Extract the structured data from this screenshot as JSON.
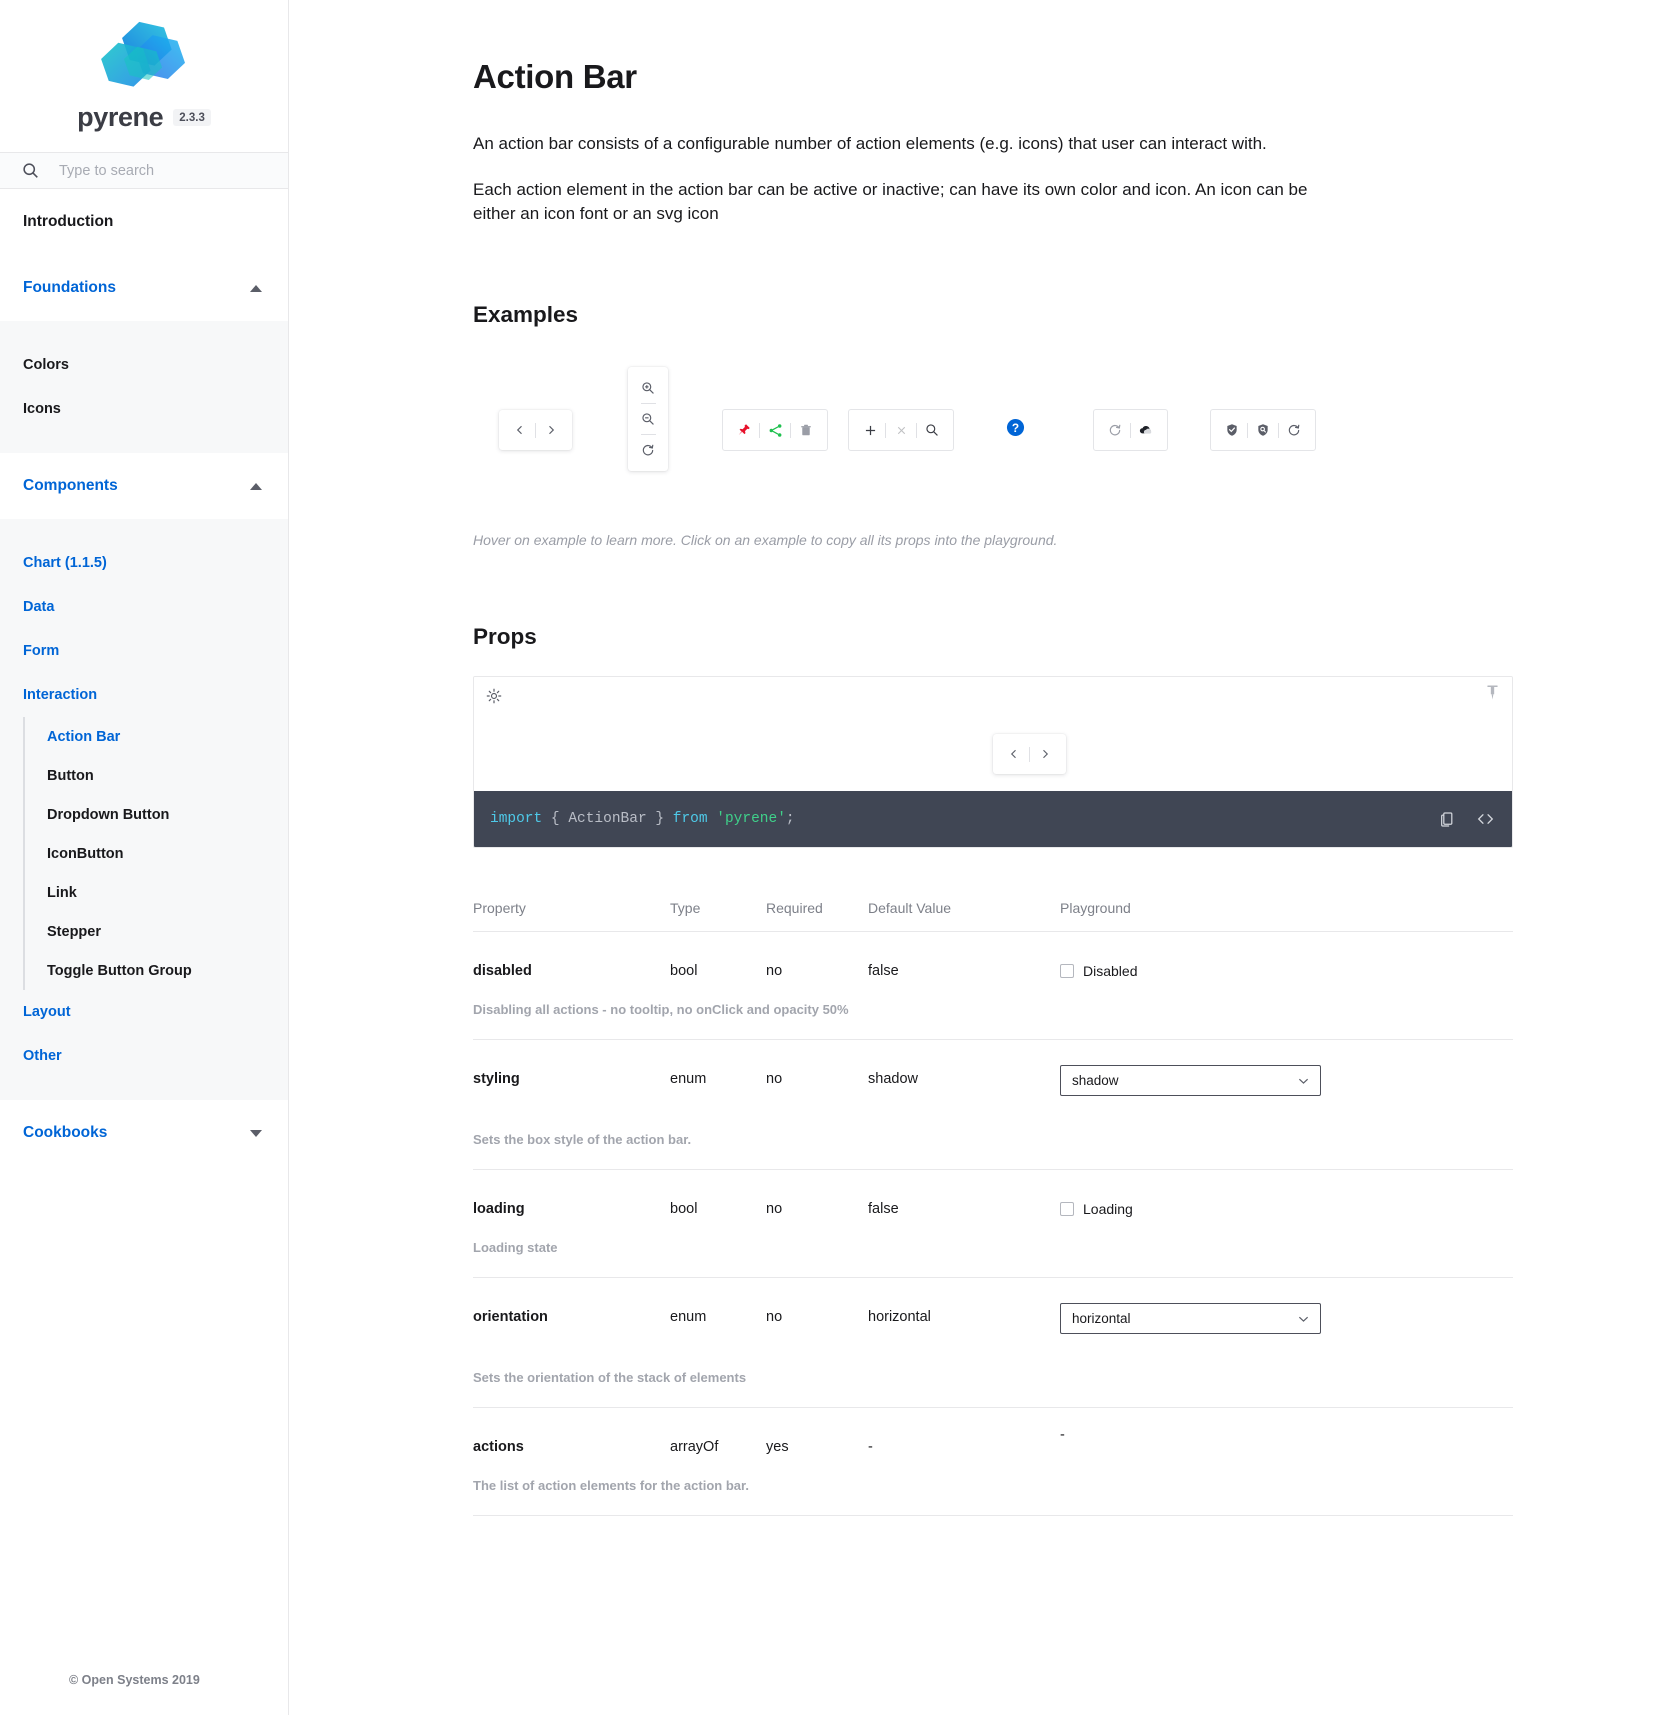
{
  "brand": {
    "name": "pyrene",
    "version": "2.3.3",
    "logo_icon": "pyrene-cube-logo"
  },
  "search": {
    "placeholder": "Type to search",
    "value": "",
    "icon": "search-icon"
  },
  "sidebar": {
    "introduction": "Introduction",
    "foundations": {
      "label": "Foundations",
      "chevron": "chevron-up-icon",
      "items": [
        "Colors",
        "Icons"
      ]
    },
    "components": {
      "label": "Components",
      "chevron": "chevron-up-icon",
      "items": [
        {
          "label": "Chart (1.1.5)"
        },
        {
          "label": "Data"
        },
        {
          "label": "Form"
        },
        {
          "label": "Interaction",
          "children": [
            "Action Bar",
            "Button",
            "Dropdown Button",
            "IconButton",
            "Link",
            "Stepper",
            "Toggle Button Group"
          ],
          "active_child": "Action Bar"
        },
        {
          "label": "Layout"
        },
        {
          "label": "Other"
        }
      ]
    },
    "cookbooks": {
      "label": "Cookbooks",
      "chevron": "chevron-down-icon"
    }
  },
  "footer": {
    "copyright": "© Open Systems 2019"
  },
  "page": {
    "title": "Action Bar",
    "paragraphs": [
      "An action bar consists of a configurable number of action elements (e.g. icons) that user can interact with.",
      "Each action element in the action bar can be active or inactive; can have its own color and icon. An icon can be either an icon font or an svg icon"
    ]
  },
  "examples": {
    "heading": "Examples",
    "hint": "Hover on example to learn more. Click on an example to copy all its props into the playground.",
    "bars": [
      {
        "orientation": "horizontal",
        "styling": "shadow",
        "actions": [
          {
            "icon": "chevron-left-icon",
            "color": "#5b5e68"
          },
          {
            "icon": "chevron-right-icon",
            "color": "#5b5e68"
          }
        ]
      },
      {
        "orientation": "vertical",
        "styling": "shadow",
        "actions": [
          {
            "icon": "zoom-in-icon",
            "color": "#5b5e68"
          },
          {
            "icon": "zoom-out-icon",
            "color": "#5b5e68"
          },
          {
            "icon": "refresh-icon",
            "color": "#5b5e68"
          }
        ]
      },
      {
        "orientation": "horizontal",
        "styling": "outline",
        "actions": [
          {
            "icon": "pin-icon",
            "color": "#e7112b"
          },
          {
            "icon": "share-icon",
            "color": "#1ec04e"
          },
          {
            "icon": "trash-icon",
            "color": "#9a9da6"
          }
        ]
      },
      {
        "orientation": "horizontal",
        "styling": "outline",
        "actions": [
          {
            "icon": "plus-icon",
            "color": "#3b3d45"
          },
          {
            "icon": "close-icon",
            "color": "#3b3d45",
            "disabled": true
          },
          {
            "icon": "search-icon",
            "color": "#3b3d45"
          }
        ]
      },
      {
        "orientation": "horizontal",
        "styling": "none",
        "actions": [
          {
            "icon": "help-badge-icon",
            "color": "#0065d6"
          }
        ]
      },
      {
        "orientation": "horizontal",
        "styling": "outline",
        "actions": [
          {
            "icon": "refresh-icon",
            "color": "#9a9da6"
          },
          {
            "icon": "cloud-icon",
            "color": "#3b3d45"
          }
        ]
      },
      {
        "orientation": "horizontal",
        "styling": "outline",
        "actions": [
          {
            "icon": "shield-check-icon",
            "color": "#5b5e68"
          },
          {
            "icon": "shield-search-icon",
            "color": "#5b5e68"
          },
          {
            "icon": "refresh-icon",
            "color": "#5b5e68"
          }
        ]
      }
    ]
  },
  "props": {
    "heading": "Props",
    "playground": {
      "spinner_icon": "loading-spinner-icon",
      "pin_icon": "pin-icon",
      "preview_actions": [
        {
          "icon": "chevron-left-icon"
        },
        {
          "icon": "chevron-right-icon"
        }
      ],
      "code": {
        "kw_import": "import",
        "brace_open": "{ ",
        "component": "ActionBar",
        "brace_close": " } ",
        "kw_from": "from",
        "module": "'pyrene'",
        "semi": ";"
      },
      "copy_icon": "copy-icon",
      "code_icon": "code-brackets-icon"
    },
    "columns": [
      "Property",
      "Type",
      "Required",
      "Default Value",
      "Playground"
    ],
    "rows": [
      {
        "property": "disabled",
        "type": "bool",
        "required": "no",
        "default": "false",
        "description": "Disabling all actions - no tooltip, no onClick and opacity 50%",
        "playground": {
          "kind": "checkbox",
          "label": "Disabled",
          "checked": false
        }
      },
      {
        "property": "styling",
        "type": "enum",
        "required": "no",
        "default": "shadow",
        "description": "Sets the box style of the action bar.",
        "playground": {
          "kind": "select",
          "value": "shadow",
          "chevron": "chevron-down-icon"
        }
      },
      {
        "property": "loading",
        "type": "bool",
        "required": "no",
        "default": "false",
        "description": "Loading state",
        "playground": {
          "kind": "checkbox",
          "label": "Loading",
          "checked": false
        }
      },
      {
        "property": "orientation",
        "type": "enum",
        "required": "no",
        "default": "horizontal",
        "description": "Sets the orientation of the stack of elements",
        "playground": {
          "kind": "select",
          "value": "horizontal",
          "chevron": "chevron-down-icon"
        }
      },
      {
        "property": "actions",
        "type": "arrayOf",
        "required": "yes",
        "default": "-",
        "description": "The list of action elements for the action bar.",
        "playground": {
          "kind": "text",
          "value": "-"
        }
      }
    ]
  },
  "colors": {
    "accent": "#0065d6",
    "code_bg": "#404654",
    "text": "#19191c",
    "muted": "#7d8089"
  }
}
